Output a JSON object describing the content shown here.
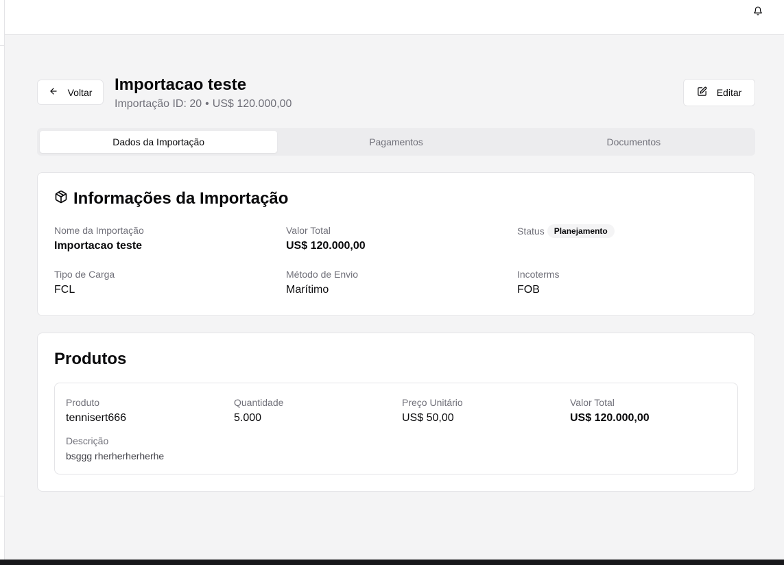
{
  "header": {
    "back_label": "Voltar",
    "title": "Importacao teste",
    "subtitle_id": "Importação ID: 20",
    "subtitle_sep": "•",
    "subtitle_value": "US$ 120.000,00",
    "edit_label": "Editar"
  },
  "tabs": [
    {
      "label": "Dados da Importação",
      "active": true
    },
    {
      "label": "Pagamentos",
      "active": false
    },
    {
      "label": "Documentos",
      "active": false
    }
  ],
  "info": {
    "title": "Informações da Importação",
    "nome_label": "Nome da Importação",
    "nome_value": "Importacao teste",
    "valor_label": "Valor Total",
    "valor_value": "US$ 120.000,00",
    "status_label": "Status",
    "status_value": "Planejamento",
    "tipo_label": "Tipo de Carga",
    "tipo_value": "FCL",
    "metodo_label": "Método de Envio",
    "metodo_value": "Marítimo",
    "incoterms_label": "Incoterms",
    "incoterms_value": "FOB"
  },
  "produtos": {
    "title": "Produtos",
    "items": [
      {
        "produto_label": "Produto",
        "produto_value": "tennisert666",
        "quantidade_label": "Quantidade",
        "quantidade_value": "5.000",
        "preco_label": "Preço Unitário",
        "preco_value": "US$ 50,00",
        "total_label": "Valor Total",
        "total_value": "US$ 120.000,00",
        "descricao_label": "Descrição",
        "descricao_value": "bsggg rherherherherhe"
      }
    ]
  },
  "icons": {
    "bell": "bell-icon",
    "back": "arrow-left-icon",
    "edit": "edit-icon",
    "package": "package-icon"
  }
}
